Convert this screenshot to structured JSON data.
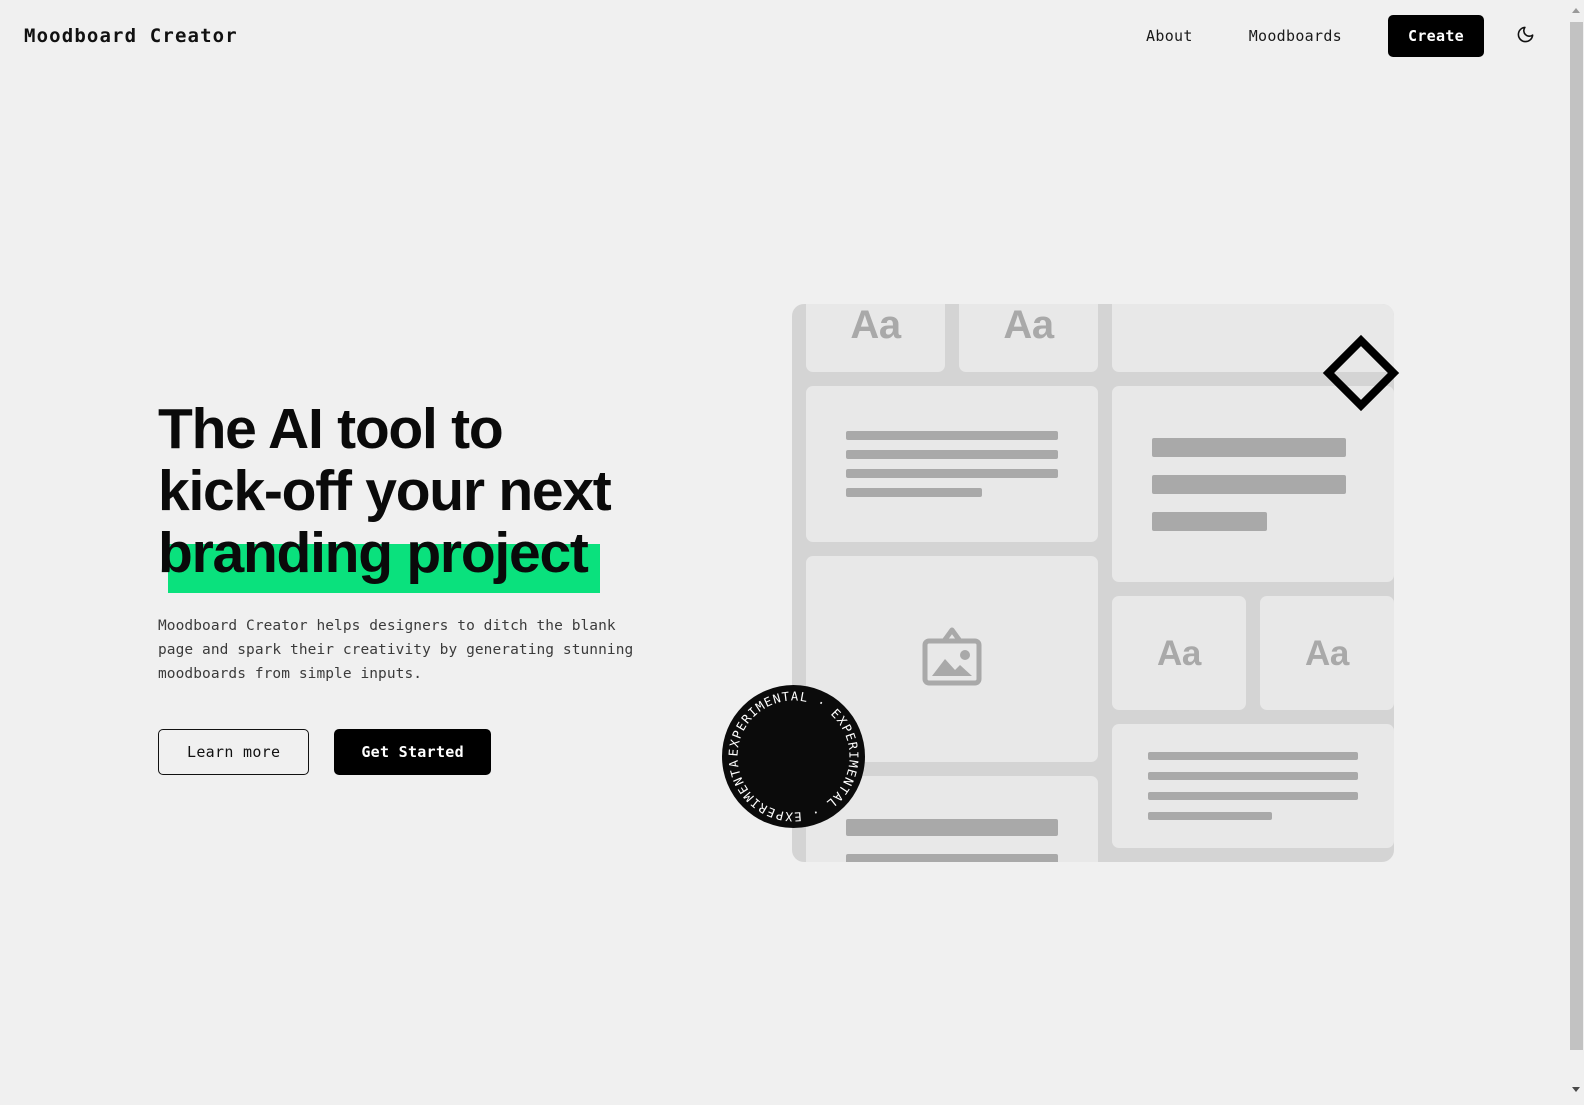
{
  "brand": {
    "logo": "Moodboard Creator"
  },
  "header": {
    "nav": [
      {
        "label": "About",
        "name": "nav-link-about"
      },
      {
        "label": "Moodboards",
        "name": "nav-link-moodboards"
      }
    ],
    "cta_label": "Create",
    "theme_toggle_icon": "moon-icon"
  },
  "hero": {
    "headline_line1": "The AI tool to",
    "headline_line2": "kick-off your next",
    "headline_line3": "branding project",
    "headline_highlight_color": "#0AE17D",
    "subcopy": "Moodboard Creator helps designers to ditch the blank page and spark their creativity by generating stunning moodboards from simple inputs.",
    "primary_button": "Get Started",
    "secondary_button": "Learn more"
  },
  "mockup": {
    "badge_text": "EXPERIMENTAL · EXPERIMENTAL · EXPERIMENTAL · ",
    "type_sample_label": "Aa",
    "image_placeholder_icon": "image-placeholder-icon",
    "diamond_icon": "diamond-outline-icon",
    "colors": {
      "board_background": "#D4D4D4",
      "card_background": "#E8E8E8",
      "placeholder_bar": "#A9A9A9",
      "badge_background": "#000000"
    },
    "cards": [
      {
        "name": "type-card-1",
        "kind": "type",
        "label": "Aa"
      },
      {
        "name": "type-card-2",
        "kind": "type",
        "label": "Aa"
      },
      {
        "name": "text-card-1",
        "kind": "lines",
        "lines": 4
      },
      {
        "name": "image-card",
        "kind": "image"
      },
      {
        "name": "text-card-bottom-left",
        "kind": "bars",
        "lines": 2
      },
      {
        "name": "spacer-card",
        "kind": "blank"
      },
      {
        "name": "text-card-2",
        "kind": "bars",
        "lines": 3
      },
      {
        "name": "type-card-3",
        "kind": "type",
        "label": "Aa"
      },
      {
        "name": "type-card-4",
        "kind": "type",
        "label": "Aa"
      },
      {
        "name": "text-card-bottom-right",
        "kind": "lines",
        "lines": 4
      }
    ]
  },
  "scrollbar": {
    "up_arrow": "scroll-up-arrow-icon",
    "down_arrow": "scroll-down-arrow-icon"
  }
}
